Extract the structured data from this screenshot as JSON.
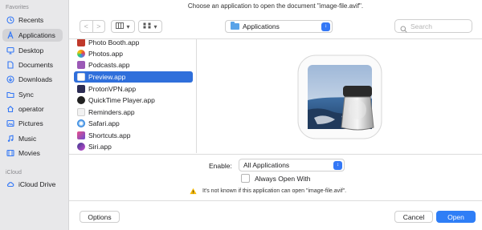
{
  "sidebar": {
    "favorites_label": "Favorites",
    "items": [
      {
        "label": "Recents",
        "icon": "clock-icon"
      },
      {
        "label": "Applications",
        "icon": "applications-icon"
      },
      {
        "label": "Desktop",
        "icon": "desktop-icon"
      },
      {
        "label": "Documents",
        "icon": "document-icon"
      },
      {
        "label": "Downloads",
        "icon": "download-icon"
      },
      {
        "label": "Sync",
        "icon": "folder-icon"
      },
      {
        "label": "operator",
        "icon": "home-icon"
      },
      {
        "label": "Pictures",
        "icon": "pictures-icon"
      },
      {
        "label": "Music",
        "icon": "music-icon"
      },
      {
        "label": "Movies",
        "icon": "movies-icon"
      }
    ],
    "icloud_label": "iCloud",
    "icloud_items": [
      {
        "label": "iCloud Drive",
        "icon": "cloud-icon"
      }
    ],
    "selected": "Applications"
  },
  "dialog": {
    "prompt": "Choose an application to open the document \"image-file.avif\"."
  },
  "toolbar": {
    "back": "<",
    "forward": ">",
    "location": "Applications",
    "search_placeholder": "Search",
    "search_value": ""
  },
  "files": [
    {
      "label": "Photo Booth.app",
      "color": "#c0392b"
    },
    {
      "label": "Photos.app",
      "color": "#f39c12"
    },
    {
      "label": "Podcasts.app",
      "color": "#9b59b6"
    },
    {
      "label": "Preview.app",
      "color": "#5d8fd6"
    },
    {
      "label": "ProtonVPN.app",
      "color": "#2c2c54"
    },
    {
      "label": "QuickTime Player.app",
      "color": "#222222"
    },
    {
      "label": "Reminders.app",
      "color": "#e0e0e0"
    },
    {
      "label": "Safari.app",
      "color": "#2f86e0"
    },
    {
      "label": "Shortcuts.app",
      "color": "#6a4ed1"
    },
    {
      "label": "Siri.app",
      "color": "#3a3a8c"
    }
  ],
  "selected_file": "Preview.app",
  "enable": {
    "label": "Enable:",
    "value": "All Applications"
  },
  "always_open_with": {
    "label": "Always Open With",
    "checked": false
  },
  "warning": "It's not known if this application can open \"image-file.avif\".",
  "buttons": {
    "options": "Options",
    "cancel": "Cancel",
    "open": "Open"
  },
  "colors": {
    "accent": "#2f7ef6",
    "selection": "#2f6fdb",
    "sidebar_bg": "#e8e8ea",
    "warning": "#f5b700"
  }
}
